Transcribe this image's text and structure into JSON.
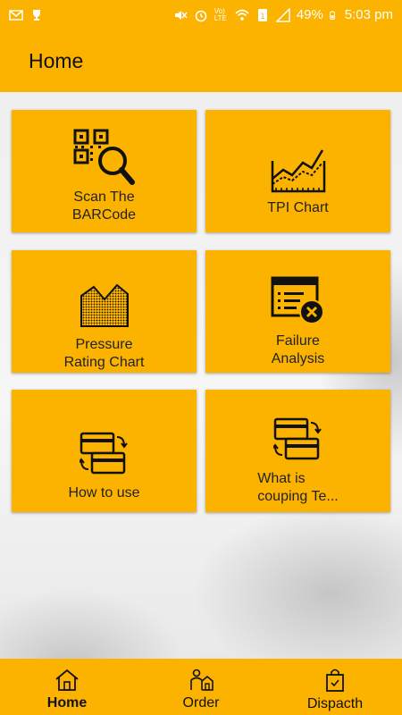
{
  "status_bar": {
    "battery": "49%",
    "time": "5:03 pm",
    "network": "Vo) LTE",
    "icons": [
      "gmail-icon",
      "trophy-icon",
      "mute-icon",
      "alarm-icon",
      "volte-icon",
      "wifi-icon",
      "sim-icon",
      "signal-icon",
      "battery-icon"
    ]
  },
  "app_bar": {
    "title": "Home"
  },
  "cards": [
    {
      "label": "Scan The\nBARCode",
      "icon": "qr-scan-icon"
    },
    {
      "label": "TPI Chart",
      "icon": "line-chart-icon"
    },
    {
      "label": "Pressure\nRating Chart",
      "icon": "area-chart-icon"
    },
    {
      "label": "Failure\nAnalysis",
      "icon": "failure-form-icon"
    },
    {
      "label": "How to use",
      "icon": "card-exchange-icon"
    },
    {
      "label": "What is\ncouping Te...",
      "icon": "card-exchange-icon"
    }
  ],
  "bottom_nav": [
    {
      "label": "Home",
      "icon": "home-icon",
      "active": true
    },
    {
      "label": "Order",
      "icon": "order-person-icon",
      "active": false
    },
    {
      "label": "Dispacth",
      "icon": "shopping-bag-icon",
      "active": false
    }
  ],
  "colors": {
    "accent": "#fcb300",
    "text": "#222222",
    "status_text": "#ffffff"
  }
}
